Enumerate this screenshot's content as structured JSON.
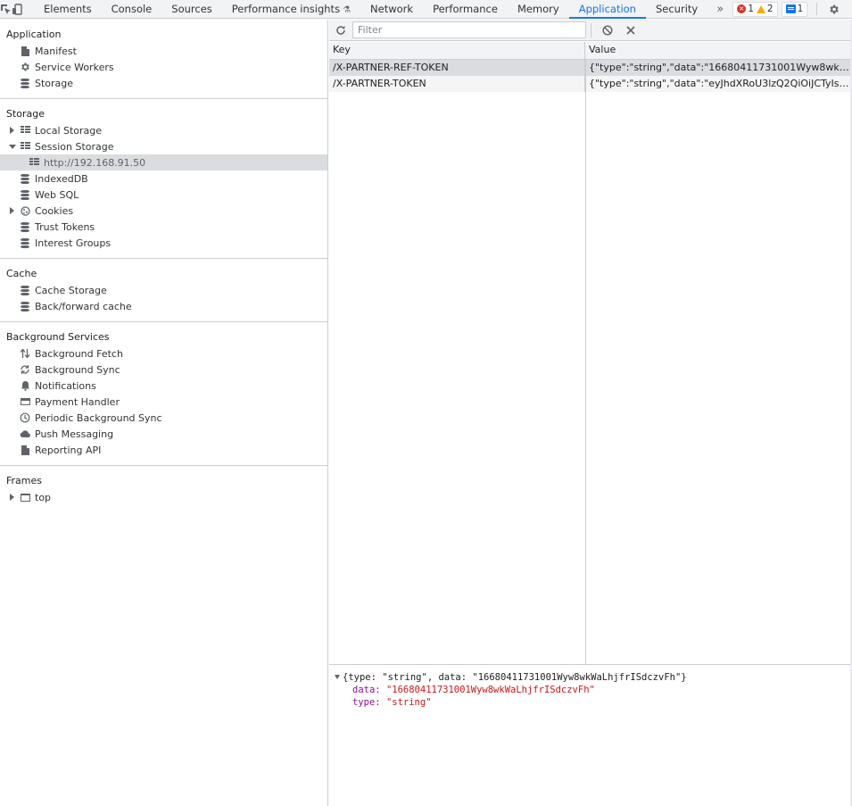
{
  "tabbar": {
    "tabs": [
      {
        "label": "Elements"
      },
      {
        "label": "Console"
      },
      {
        "label": "Sources"
      },
      {
        "label": "Performance insights"
      },
      {
        "label": "Network"
      },
      {
        "label": "Performance"
      },
      {
        "label": "Memory"
      },
      {
        "label": "Application"
      },
      {
        "label": "Security"
      }
    ],
    "active_tab": "Application",
    "more_label": "»",
    "errors": "1",
    "warnings": "2",
    "messages": "1"
  },
  "sidebar": {
    "application": {
      "heading": "Application",
      "items": [
        {
          "label": "Manifest",
          "icon": "file-icon"
        },
        {
          "label": "Service Workers",
          "icon": "gear-icon"
        },
        {
          "label": "Storage",
          "icon": "database-icon"
        }
      ]
    },
    "storage": {
      "heading": "Storage",
      "items": [
        {
          "label": "Local Storage",
          "icon": "grid-icon",
          "expanded": false
        },
        {
          "label": "Session Storage",
          "icon": "grid-icon",
          "expanded": true
        },
        {
          "label": "http://192.168.91.50",
          "icon": "grid-icon",
          "selected": true
        },
        {
          "label": "IndexedDB",
          "icon": "database-icon"
        },
        {
          "label": "Web SQL",
          "icon": "database-icon"
        },
        {
          "label": "Cookies",
          "icon": "cookie-icon",
          "expanded": false
        },
        {
          "label": "Trust Tokens",
          "icon": "database-icon"
        },
        {
          "label": "Interest Groups",
          "icon": "database-icon"
        }
      ]
    },
    "cache": {
      "heading": "Cache",
      "items": [
        {
          "label": "Cache Storage",
          "icon": "database-icon"
        },
        {
          "label": "Back/forward cache",
          "icon": "database-icon"
        }
      ]
    },
    "background": {
      "heading": "Background Services",
      "items": [
        {
          "label": "Background Fetch",
          "icon": "up-down-arrows-icon"
        },
        {
          "label": "Background Sync",
          "icon": "sync-icon"
        },
        {
          "label": "Notifications",
          "icon": "bell-icon"
        },
        {
          "label": "Payment Handler",
          "icon": "card-icon"
        },
        {
          "label": "Periodic Background Sync",
          "icon": "clock-icon"
        },
        {
          "label": "Push Messaging",
          "icon": "cloud-icon"
        },
        {
          "label": "Reporting API",
          "icon": "file-icon"
        }
      ]
    },
    "frames": {
      "heading": "Frames",
      "items": [
        {
          "label": "top",
          "icon": "frame-icon",
          "expanded": false
        }
      ]
    }
  },
  "toolbar": {
    "filter_placeholder": "Filter"
  },
  "table": {
    "columns": [
      "Key",
      "Value"
    ],
    "rows": [
      {
        "key": "/X-PARTNER-REF-TOKEN",
        "value": "{\"type\":\"string\",\"data\":\"16680411731001Wyw8wkWaLhjfr…",
        "selected": true
      },
      {
        "key": "/X-PARTNER-TOKEN",
        "value": "{\"type\":\"string\",\"data\":\"eyJhdXRoU3lzQ2QiOiJCTyIsImFsZ…",
        "selected": false
      }
    ]
  },
  "preview": {
    "summary_prefix": "{type: \"string\", data: \"16680411731001Wyw8wkWaLhjfrISdczvFh\"}",
    "data_key": "data: ",
    "data_value": "\"16680411731001Wyw8wkWaLhjfrISdczvFh\"",
    "type_key": "type: ",
    "type_value": "\"string\""
  }
}
